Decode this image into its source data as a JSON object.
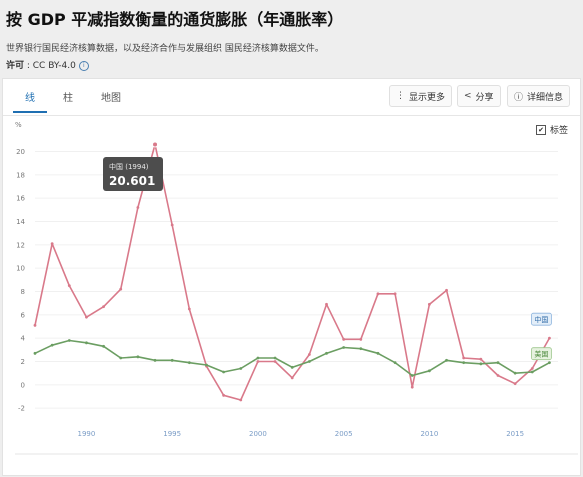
{
  "header": {
    "title": "按 GDP 平减指数衡量的通货膨胀（年通胀率）",
    "source": "世界银行国民经济核算数据，以及经济合作与发展组织 国民经济核算数据文件。",
    "license_label": "许可",
    "license_value": " : CC BY-4.0"
  },
  "tabs": [
    {
      "label": "线"
    },
    {
      "label": "柱"
    },
    {
      "label": "地图"
    }
  ],
  "buttons": {
    "more": "显示更多",
    "share": "分享",
    "details": "详细信息"
  },
  "legend_toggle": {
    "label": "标签",
    "checked": true
  },
  "icons": {
    "more": "more-icon",
    "share": "share-icon",
    "details": "info-icon"
  },
  "tooltip": {
    "label": "中国 (1994)",
    "value": "20.601"
  },
  "chart_data": {
    "type": "line",
    "x": [
      1987,
      1988,
      1989,
      1990,
      1991,
      1992,
      1993,
      1994,
      1995,
      1996,
      1997,
      1998,
      1999,
      2000,
      2001,
      2002,
      2003,
      2004,
      2005,
      2006,
      2007,
      2008,
      2009,
      2010,
      2011,
      2012,
      2013,
      2014,
      2015,
      2016,
      2017
    ],
    "series": [
      {
        "name": "中国",
        "color": "#d9798a",
        "values": [
          5.1,
          12.1,
          8.5,
          5.8,
          6.7,
          8.2,
          15.2,
          20.6,
          13.7,
          6.5,
          1.6,
          -0.9,
          -1.3,
          2.0,
          2.0,
          0.6,
          2.6,
          6.9,
          3.9,
          3.9,
          7.8,
          7.8,
          -0.2,
          6.9,
          8.1,
          2.3,
          2.2,
          0.8,
          0.1,
          1.4,
          4.0
        ]
      },
      {
        "name": "美国",
        "color": "#6b9e62",
        "values": [
          2.7,
          3.4,
          3.8,
          3.6,
          3.3,
          2.3,
          2.4,
          2.1,
          2.1,
          1.9,
          1.7,
          1.1,
          1.4,
          2.3,
          2.3,
          1.5,
          2.0,
          2.7,
          3.2,
          3.1,
          2.7,
          1.9,
          0.8,
          1.2,
          2.1,
          1.9,
          1.8,
          1.9,
          1.0,
          1.1,
          1.9
        ]
      }
    ],
    "ylabel": "%",
    "yticks": [
      -2,
      0,
      2,
      4,
      6,
      8,
      10,
      12,
      14,
      16,
      18,
      20
    ],
    "xticks": [
      1990,
      1995,
      2000,
      2005,
      2010,
      2015
    ],
    "ylim": [
      -2.5,
      21.5
    ],
    "xlim": [
      1987,
      2017.5
    ],
    "grid": true
  }
}
